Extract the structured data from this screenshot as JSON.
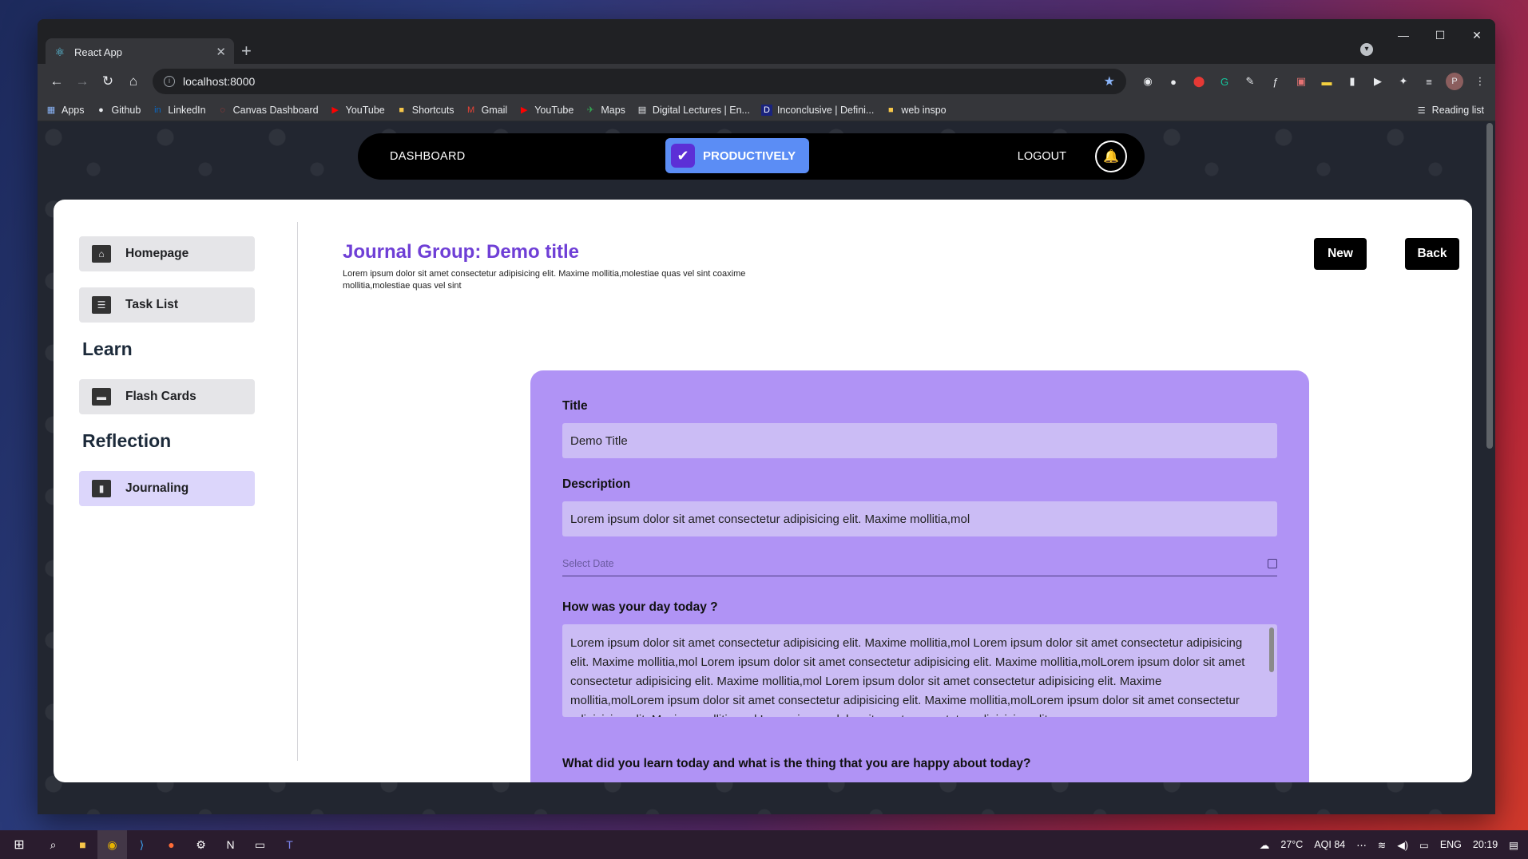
{
  "browser": {
    "tab_title": "React App",
    "new_tab": "+",
    "url": "localhost:8000",
    "bookmarks": [
      "Apps",
      "Github",
      "LinkedIn",
      "Canvas Dashboard",
      "YouTube",
      "Shortcuts",
      "Gmail",
      "YouTube",
      "Maps",
      "Digital Lectures | En...",
      "Inconclusive | Defini...",
      "web inspo"
    ],
    "reading_list": "Reading list",
    "profile_initial": "P"
  },
  "nav": {
    "dashboard": "DASHBOARD",
    "brand": "PRODUCTIVELY",
    "logout": "LOGOUT"
  },
  "sidebar": {
    "homepage": "Homepage",
    "task_list": "Task List",
    "learn_heading": "Learn",
    "flash_cards": "Flash Cards",
    "reflection_heading": "Reflection",
    "journaling": "Journaling"
  },
  "page": {
    "title": "Journal Group: Demo title",
    "description": "Lorem ipsum dolor sit amet consectetur adipisicing elit. Maxime mollitia,molestiae quas vel sint coaxime mollitia,molestiae quas vel sint",
    "new_label": "New",
    "back_label": "Back"
  },
  "form": {
    "title_label": "Title",
    "title_value": "Demo Title",
    "description_label": "Description",
    "description_value": "Lorem ipsum dolor sit amet consectetur adipisicing elit. Maxime mollitia,mol",
    "date_placeholder": "Select Date",
    "q1_label": "How was your day today ?",
    "q1_value": "Lorem ipsum dolor sit amet consectetur adipisicing elit. Maxime mollitia,mol Lorem ipsum dolor sit amet consectetur adipisicing elit. Maxime mollitia,mol Lorem ipsum dolor sit amet consectetur adipisicing elit. Maxime mollitia,molLorem ipsum dolor sit amet consectetur adipisicing elit. Maxime mollitia,mol Lorem ipsum dolor sit amet consectetur adipisicing elit. Maxime mollitia,molLorem ipsum dolor sit amet consectetur adipisicing elit. Maxime mollitia,molLorem ipsum dolor sit amet consectetur adipisicing elit. Maxime mollitia,mol Lorem ipsum dolor sit amet consectetur adipisicing elit.",
    "q2_label": "What did you learn today and what is the thing that you are happy about today?"
  },
  "taskbar": {
    "weather": "27°C",
    "aqi": "AQI 84",
    "lang": "ENG",
    "time": "20:19"
  },
  "colors": {
    "accent": "#6f3fd6",
    "form_bg": "#b093f5",
    "field_bg": "#cbbcf5",
    "brand_blue": "#5b8df5"
  }
}
